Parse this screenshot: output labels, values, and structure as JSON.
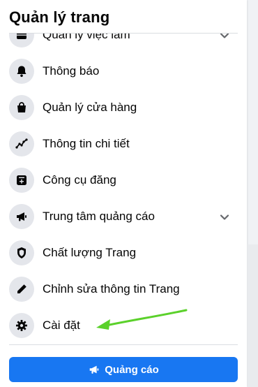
{
  "panel": {
    "title": "Quản lý trang"
  },
  "menu": {
    "items": [
      {
        "label": "Quản lý việc làm",
        "icon": "briefcase-icon",
        "has_chevron": true
      },
      {
        "label": "Thông báo",
        "icon": "bell-icon",
        "has_chevron": false
      },
      {
        "label": "Quản lý cửa hàng",
        "icon": "shopping-bag-icon",
        "has_chevron": false
      },
      {
        "label": "Thông tin chi tiết",
        "icon": "insights-graph-icon",
        "has_chevron": false
      },
      {
        "label": "Công cụ đăng",
        "icon": "publishing-tools-icon",
        "has_chevron": false
      },
      {
        "label": "Trung tâm quảng cáo",
        "icon": "megaphone-icon",
        "has_chevron": true
      },
      {
        "label": "Chất lượng Trang",
        "icon": "shield-icon",
        "has_chevron": false
      },
      {
        "label": "Chỉnh sửa thông tin Trang",
        "icon": "pencil-icon",
        "has_chevron": false
      },
      {
        "label": "Cài đặt",
        "icon": "gear-icon",
        "has_chevron": false
      }
    ]
  },
  "promote_button": {
    "label": "Quảng cáo",
    "icon": "megaphone-icon",
    "color": "#1877f2"
  },
  "annotation": {
    "arrow_color": "#5bd12b"
  }
}
